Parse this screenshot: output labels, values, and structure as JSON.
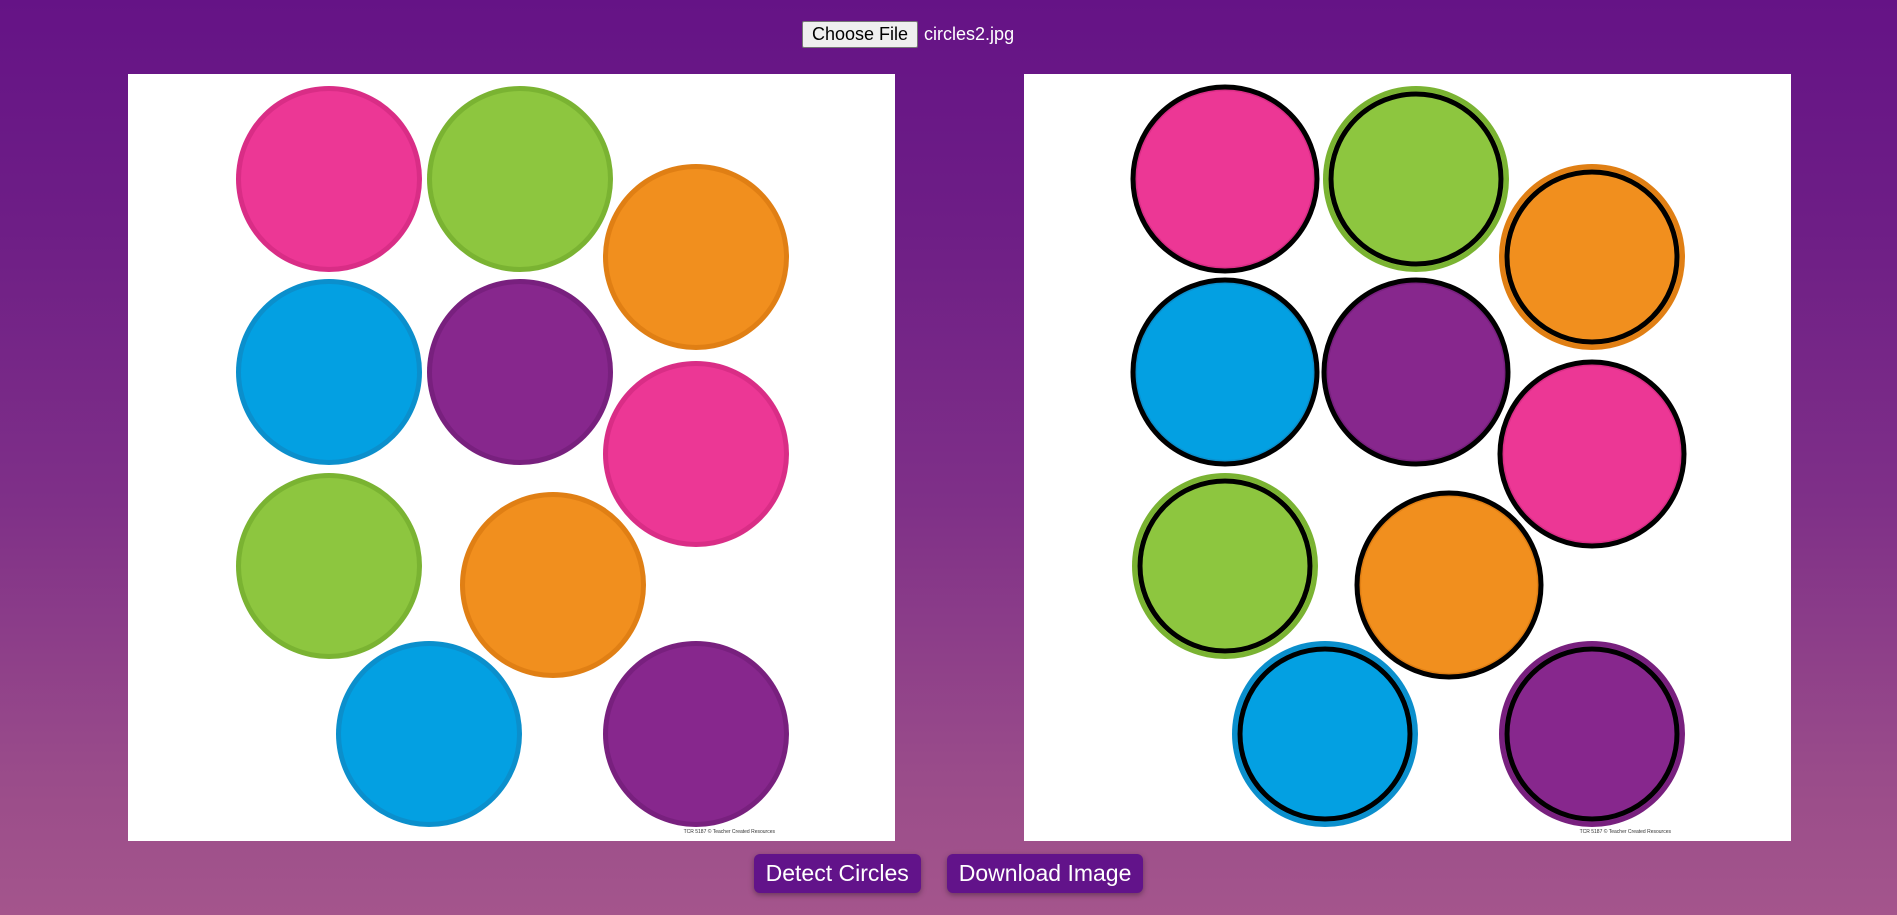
{
  "file_input": {
    "button_label": "Choose File",
    "file_name": "circles2.jpg"
  },
  "original_panel": {
    "credit_text": "TCR 5187 © Teacher Created Resources"
  },
  "result_panel": {
    "credit_text": "TCR 5187 © Teacher Created Resources"
  },
  "buttons": {
    "detect_label": "Detect Circles",
    "download_label": "Download Image"
  },
  "circles": [
    {
      "color": "#ec3795",
      "edge": "#d92d86",
      "detected": "tight"
    },
    {
      "color": "#8dc63f",
      "edge": "#7ab332",
      "detected": "inner"
    },
    {
      "color": "#f18f1e",
      "edge": "#e07f14",
      "detected": "inner"
    },
    {
      "color": "#03a0e2",
      "edge": "#0b8fcc",
      "detected": "tight"
    },
    {
      "color": "#87278d",
      "edge": "#78207e",
      "detected": "tight"
    },
    {
      "color": "#ec3795",
      "edge": "#d92d86",
      "detected": "tight"
    },
    {
      "color": "#8dc63f",
      "edge": "#7ab332",
      "detected": "inner"
    },
    {
      "color": "#f18f1e",
      "edge": "#e07f14",
      "detected": "tight"
    },
    {
      "color": "#03a0e2",
      "edge": "#0b8fcc",
      "detected": "inner"
    },
    {
      "color": "#87278d",
      "edge": "#78207e",
      "detected": "inner"
    }
  ]
}
